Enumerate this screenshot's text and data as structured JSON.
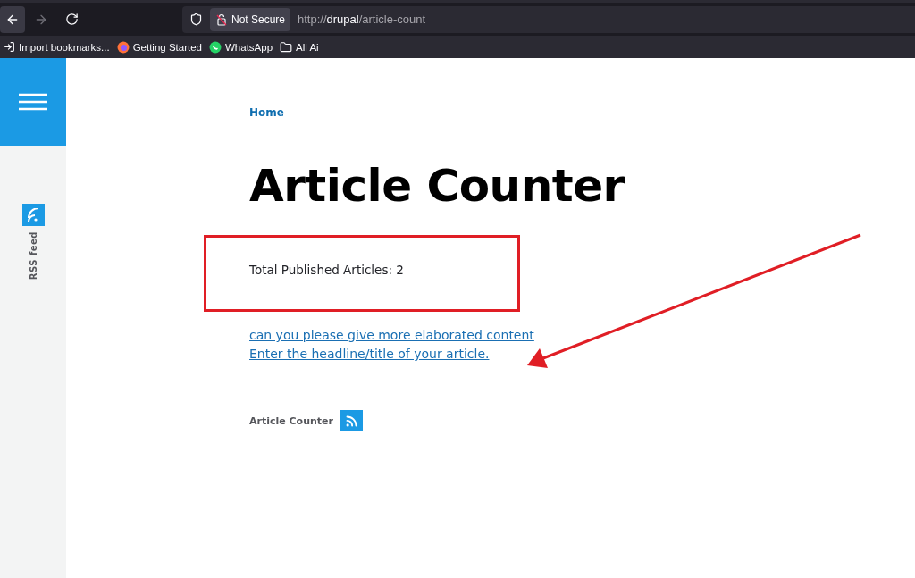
{
  "browser": {
    "nav": [
      {
        "kind": "back",
        "disabled": false
      },
      {
        "kind": "forward",
        "disabled": true
      },
      {
        "kind": "reload",
        "disabled": false
      }
    ],
    "security": "Not Secure",
    "url": {
      "scheme": "http://",
      "host": "drupal",
      "path": "/article-count"
    },
    "bookmarks": [
      {
        "kind": "import",
        "label": "Import bookmarks..."
      },
      {
        "kind": "firefox",
        "label": "Getting Started"
      },
      {
        "kind": "whatsapp",
        "label": "WhatsApp"
      },
      {
        "kind": "folder",
        "label": "All Ai"
      }
    ]
  },
  "sidebar": {
    "rss_label": "RSS feed"
  },
  "breadcrumb": "Home",
  "title": "Article Counter",
  "count_text": "Total Published Articles: 2",
  "links": [
    "can you please give more elaborated content",
    "Enter the headline/title of your article."
  ],
  "footer": {
    "label": "Article Counter"
  }
}
